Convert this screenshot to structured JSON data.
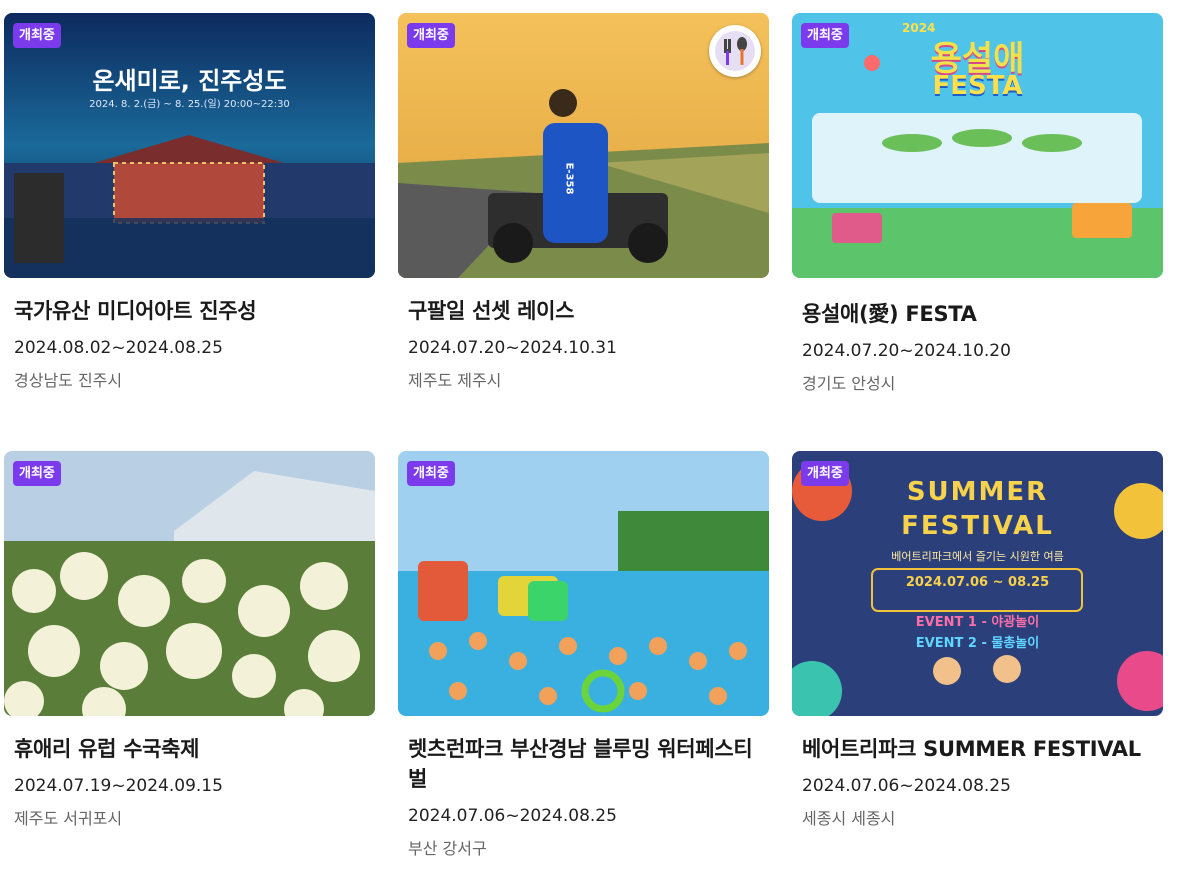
{
  "cards": [
    {
      "badge": "개최중",
      "title": "국가유산 미디어아트 진주성",
      "date": "2024.08.02~2024.08.25",
      "location": "경상남도 진주시",
      "poster_text": "온새미로, 진주성도",
      "poster_sub": "2024. 8. 2.(금) ~ 8. 25.(일) 20:00~22:30"
    },
    {
      "badge": "개최중",
      "title": "구팔일 선셋 레이스",
      "date": "2024.07.20~2024.10.31",
      "location": "제주도 제주시",
      "icon": "fork-spoon-icon",
      "kart_label": "E-358"
    },
    {
      "badge": "개최중",
      "title": "용설애(愛) FESTA",
      "date": "2024.07.20~2024.10.20",
      "location": "경기도 안성시",
      "poster_year": "2024",
      "poster_title": "용설애",
      "poster_festa": "FESTA"
    },
    {
      "badge": "개최중",
      "title": "휴애리 유럽 수국축제",
      "date": "2024.07.19~2024.09.15",
      "location": "제주도 서귀포시"
    },
    {
      "badge": "개최중",
      "title": "렛츠런파크 부산경남 블루밍 워터페스티벌",
      "date": "2024.07.06~2024.08.25",
      "location": "부산 강서구"
    },
    {
      "badge": "개최중",
      "title": "베어트리파크 SUMMER FESTIVAL",
      "date": "2024.07.06~2024.08.25",
      "location": "세종시 세종시",
      "poster_line1": "SUMMER",
      "poster_line2": "FESTIVAL",
      "poster_sub": "베어트리파크에서 즐기는 시원한 여름",
      "poster_dates": "2024.07.06 ~ 08.25",
      "poster_ev1": "EVENT 1 - 야광놀이",
      "poster_ev2": "EVENT 2 - 물총놀이"
    }
  ],
  "colors": {
    "badge": "#7c3aed"
  }
}
